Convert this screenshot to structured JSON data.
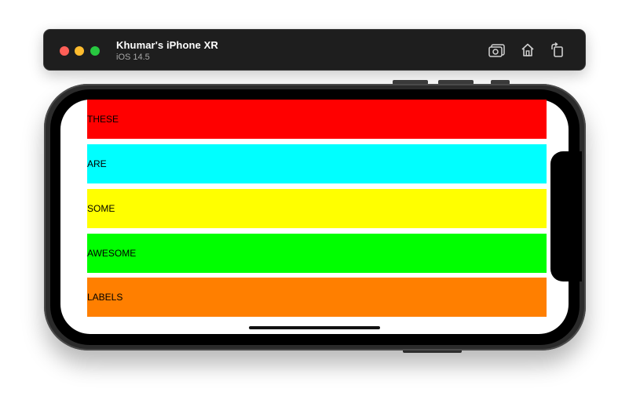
{
  "window": {
    "device_name": "Khumar's iPhone XR",
    "os_version": "iOS 14.5"
  },
  "toolbar": {
    "icons": [
      "screenshot-icon",
      "home-icon",
      "rotate-icon"
    ]
  },
  "labels": [
    {
      "text": "THESE",
      "color": "#ff0000"
    },
    {
      "text": "ARE",
      "color": "#00ffff"
    },
    {
      "text": "SOME",
      "color": "#ffff00"
    },
    {
      "text": "AWESOME",
      "color": "#00ff00"
    },
    {
      "text": "LABELS",
      "color": "#ff7f00"
    }
  ]
}
